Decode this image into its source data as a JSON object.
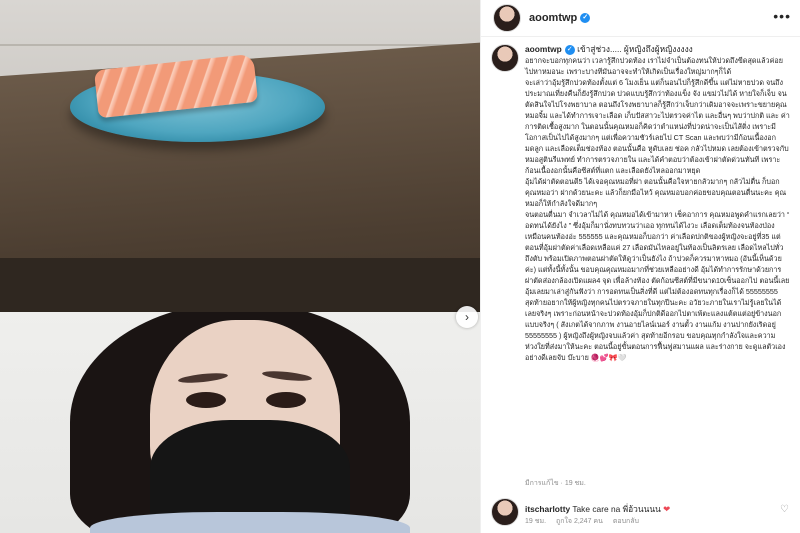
{
  "post": {
    "username": "aoomtwp",
    "header_more": "•••",
    "caption_first_line": "เข้าสู่ช่วง..... ผู้หญิงถึงผู้หญิงงงงง",
    "paragraphs": [
      "อยากจะบอกทุกคนว่า เวลารู้สึกปวดท้อง เราไม่จำเป็นต้องทนให้ปวดถึงขีดสุดแล้วค่อยไปหาหมอนะ เพราะบางทีมันอาจจะทำให้เกิดเป็นเรื่องใหญ่มากๆก็ได้",
      "จะเล่าว่าอุ้มรู้สึกปวดท้องตั้งแต่ 6 โมงเย็น แต่ก็นอนไปก็รู้สึกดีขึ้น แต่ไม่หายปวด จนถึงประมาณเที่ยงคืนก็ยังรู้สึกปวด ปวดแบบรู้สึกว่าท้องแข็ง จัง แขม่วไม่ได้ หายใจก็เจ็บ จนตัดสินใจไปโรงพยาบาล ตอนถึงโรงพยาบาลก็รู้สึกว่าเจ็บกว่าเดิมอาจจะเพราะขยายคุณหมอจิ้ม และได้ทำการเจาะเลือด เก็บปัสสาวะไปตรวจค่าไต และอื่นๆ พบว่าปกติ และ ค่าการติดเชื้อสูงมาก ในตอนนั้นคุณหมอก็คิดว่าตำแหน่งที่ปวดน่าจะเป็นไส้ติ่ง เพราะมีโอกาสเป็นไปได้สูงมากๆ แต่เพื่อความชัวร์เลยไป CT Scan และพบว่ามีก้อนเนื้องอกมดลูก และเลือดเต็มช่องท้อง ตอนนั้นคือ หูดับเลย ช่อค กลัวไปหมด เลยต้องเข้าตรวจกับหมอสูตินรีแพทย์ ทำการตรวจภายใน และได้คำตอบว่าต้องเข้าผ่าตัดด่วนทันที เพราะก้อนเนื้องอกนั้นคือซีสต์ที่แตก และเลือดยังไหลออกมาหยุด",
      "อุ้มได้ผ่าตัดตอนตี5 ได้เจอคุณหมอที่ผ่า ตอนนั้นคือใจหายกลัวมากๆ กลัวไม่ตื่น ก็บอกคุณหมอว่า ฝากด้วยนะคะ แล้วก็ยกมือไหว้ คุณหมอบอกค่อยขอบคุณตอนตื่นนะคะ คุณหมอก็ให้กำลังใจดีมากๆ",
      "จนตอนตื่นมา จำเวลาไม่ได้ คุณหมอได้เข้ามาหา เช็คอาการ คุณหมอพูดคำแรกเลยว่า “ อดทนได้ยังไง ” ซึ่งอุ้มก็มานั่งทบทวนว่าเออ ทุกทนได้ไงวะ เลือดเต็มท้องจนท้องป่องเหมือนคนท้องอ่ะ 555555 และคุณหมอก็บอกว่า ค่าเลือดปกติของผู้หญิงจะอยู่ที่35 แต่ตอนที่อุ้มผ่าตัดค่าเลือดเหลือแค่ 27 เลือดมันไหลอยู่ในท้องเป็นลิตรเลย เลือดไหลไปทั่วถึงตับ พร้อมเปิดภาพตอนผ่าตัดให้ดูว่าเป็นยังไง ถ้าปวดก็ควรมาหาหมอ (อันนี้เห็นด้วยค่ะ) แต่ทั้งนี้ทั้งนั้น ขอบคุณคุณหมอมากที่ช่วยเหลืออย่างดี อุ้มได้ทำการรักษาด้วยการผ่าตัดส่องกล้องเปิดแผล4 จุด เพื่อล้างท้อง ตัดก้อนซีสต์ที่มีขนาด10เซ็นออกไป ตอนนี้เลย อุ้มเลยมาเล่าสู่กันฟังว่า การอดทนเป็นสิ่งที่ดี แต่ไม่ต้องอดทนทุกเรื่องก็ได้ 55555555",
      "สุดท้ายอยากให้ผู้หญิงทุกคนไปตรวจภายในทุกปีนะคะ อวัยวะภายในเราไม่รู้เลยในได้เลยจริงๆ เพราะก่อนหน้าจะปวดท้องอุ้มก็ปกติดีออกไปตาเพ้ตะแลงแต้ตแต่อยู่ข้างนอกแบบจริงๆ ( สังเกตได้จากภาพ งานอายไลน์เนอร์ งานตั้ว งานแก้ม งานปากยังเริดอยู่ 55555555 ) ผู้หญิงถึงผู้หญิงจบแล้วค่า สุดท้ายอีกรอบ ขอบคุณทุกกำลังใจและความห่วงใยที่ส่งมาให้นะคะ ตอนนี้อยู่ขั้นตอนการฟื้นฟูสมานแผล และร่างกาย จะดูแลตัวเองอย่างดีเลยจับ บ๊ะบาย 🧶💕🎀🤍"
    ],
    "timestamp": "มีการแก้ไข · 19 ชม."
  },
  "comment": {
    "username": "itscharlotty",
    "text": "Take care na พี่อ้วนนนน",
    "heart": "❤",
    "time": "19 ชม.",
    "likes": "ถูกใจ 2,247 คน",
    "reply": "ตอบกลับ",
    "like_icon": "♡"
  },
  "icons": {
    "verified": "✓",
    "next": "›"
  }
}
